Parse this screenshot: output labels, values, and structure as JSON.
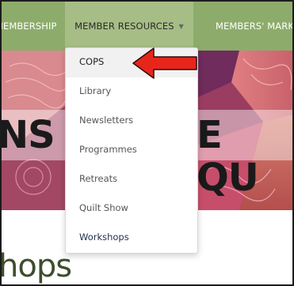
{
  "nav": {
    "items": [
      {
        "label": "MEMBERSHIP"
      },
      {
        "label": "MEMBER RESOURCES"
      },
      {
        "label": "MEMBERS' MARKET"
      }
    ]
  },
  "hero": {
    "left_text": "NS",
    "right_text": "E QU"
  },
  "dropdown": {
    "items": [
      {
        "label": "COPS"
      },
      {
        "label": "Library"
      },
      {
        "label": "Newsletters"
      },
      {
        "label": "Programmes"
      },
      {
        "label": "Retreats"
      },
      {
        "label": "Quilt Show"
      },
      {
        "label": "Workshops"
      }
    ]
  },
  "page": {
    "section_heading": "hops"
  },
  "colors": {
    "navbar": "#8dac6b",
    "navbar_active": "#a6bd86",
    "annotation_arrow": "#e8251b",
    "heading": "#3d4e2d"
  }
}
